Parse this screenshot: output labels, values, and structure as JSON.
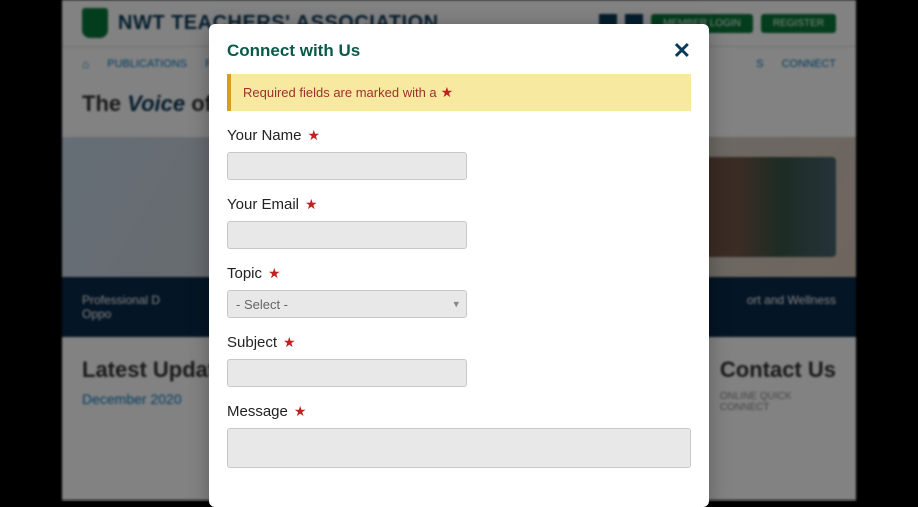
{
  "header": {
    "site_title": "NWT TEACHERS' ASSOCIATION",
    "btn_login": "MEMBER LOGIN",
    "btn_register": "REGISTER"
  },
  "nav": {
    "items": [
      "PUBLICATIONS",
      "FE"
    ],
    "right": [
      "S",
      "CONNECT"
    ]
  },
  "hero": {
    "prefix": "The ",
    "emphasis": "Voice",
    "suffix": " of N"
  },
  "bluebar": {
    "left_line1": "Professional D",
    "left_line2": "Oppo",
    "right": "ort and Wellness"
  },
  "lower": {
    "latest_title": "Latest Update",
    "latest_sub": "December 2020",
    "contact_title": "Contact Us",
    "contact_sub1": "ONLINE QUICK",
    "contact_sub2": "CONNECT"
  },
  "modal": {
    "title": "Connect with Us",
    "required_notice": "Required fields are marked with a",
    "fields": {
      "name_label": "Your Name",
      "email_label": "Your Email",
      "topic_label": "Topic",
      "topic_placeholder": "- Select -",
      "subject_label": "Subject",
      "message_label": "Message"
    }
  }
}
